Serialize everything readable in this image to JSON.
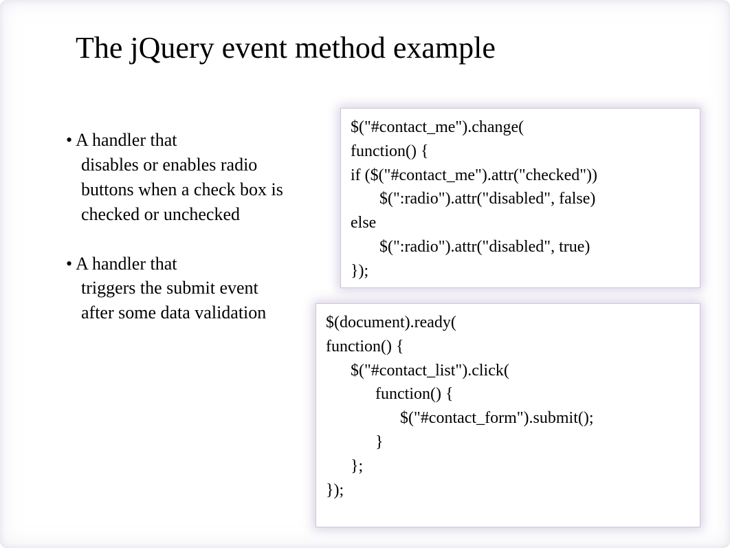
{
  "title": "The jQuery event method example",
  "bullets": [
    {
      "first": "• A handler that",
      "rest": "disables or enables radio buttons when a check box is checked or unchecked"
    },
    {
      "first": "• A handler that",
      "rest": "triggers the submit event after some data validation"
    }
  ],
  "code1": {
    "l0": "$(\"#contact_me\").change(",
    "l1": "function() {",
    "l2": "if ($(\"#contact_me\").attr(\"checked\"))",
    "l3": "       $(\":radio\").attr(\"disabled\", false)",
    "l4": "else",
    "l5": "       $(\":radio\").attr(\"disabled\", true)",
    "l6": "});"
  },
  "code2": {
    "l0": "$(document).ready(",
    "l1": "function() {",
    "l2": "      $(\"#contact_list\").click(",
    "l3": "            function() {",
    "l4": "                  $(\"#contact_form\").submit();",
    "l5": "            }",
    "l6": "      };",
    "l7": "});"
  }
}
